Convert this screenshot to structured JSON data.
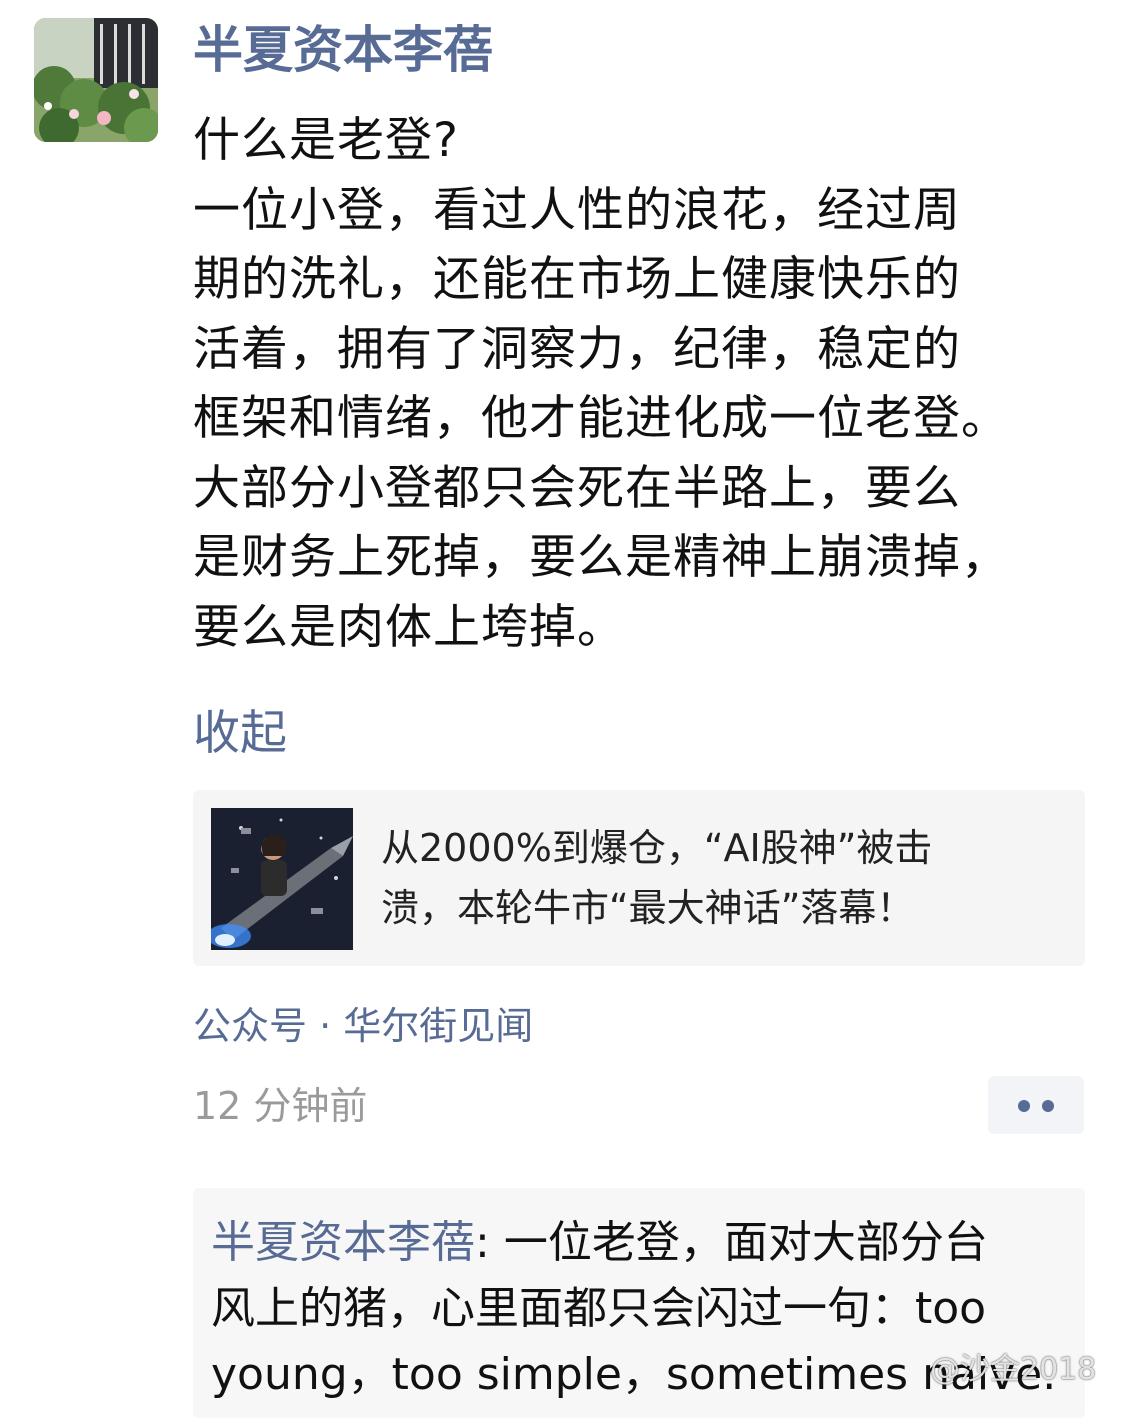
{
  "post": {
    "author": "半夏资本李蓓",
    "avatar_icon": "garden-photo-avatar",
    "body_lines": [
      "什么是老登?",
      "一位小登，看过人性的浪花，经过周",
      "期的洗礼，还能在市场上健康快乐的",
      "活着，拥有了洞察力，纪律，稳定的",
      "框架和情绪，他才能进化成一位老登。",
      "大部分小登都只会死在半路上，要么",
      "是财务上死掉，要么是精神上崩溃掉，",
      "要么是肉体上垮掉。"
    ],
    "collapse_label": "收起",
    "share_card": {
      "thumbnail_icon": "rocket-rider-thumbnail",
      "title_lines": [
        "从2000%到爆仓，“AI股神”被击",
        "溃，本轮牛市“最大神话”落幕！"
      ]
    },
    "source": "公众号 · 华尔街见闻",
    "timestamp": "12 分钟前",
    "more_icon": "more-dots-icon"
  },
  "comment": {
    "author": "半夏资本李蓓",
    "separator": ":",
    "first_line_text": " 一位老登，面对大部分台",
    "lines": [
      "风上的猪，心里面都只会闪过一句：too",
      "young，too simple，sometimes naive."
    ]
  },
  "watermark": "@沙金2018",
  "colors": {
    "link": "#576b95",
    "text": "#111111",
    "timestamp": "#9a9a9a",
    "card_bg": "#f5f5f5"
  }
}
